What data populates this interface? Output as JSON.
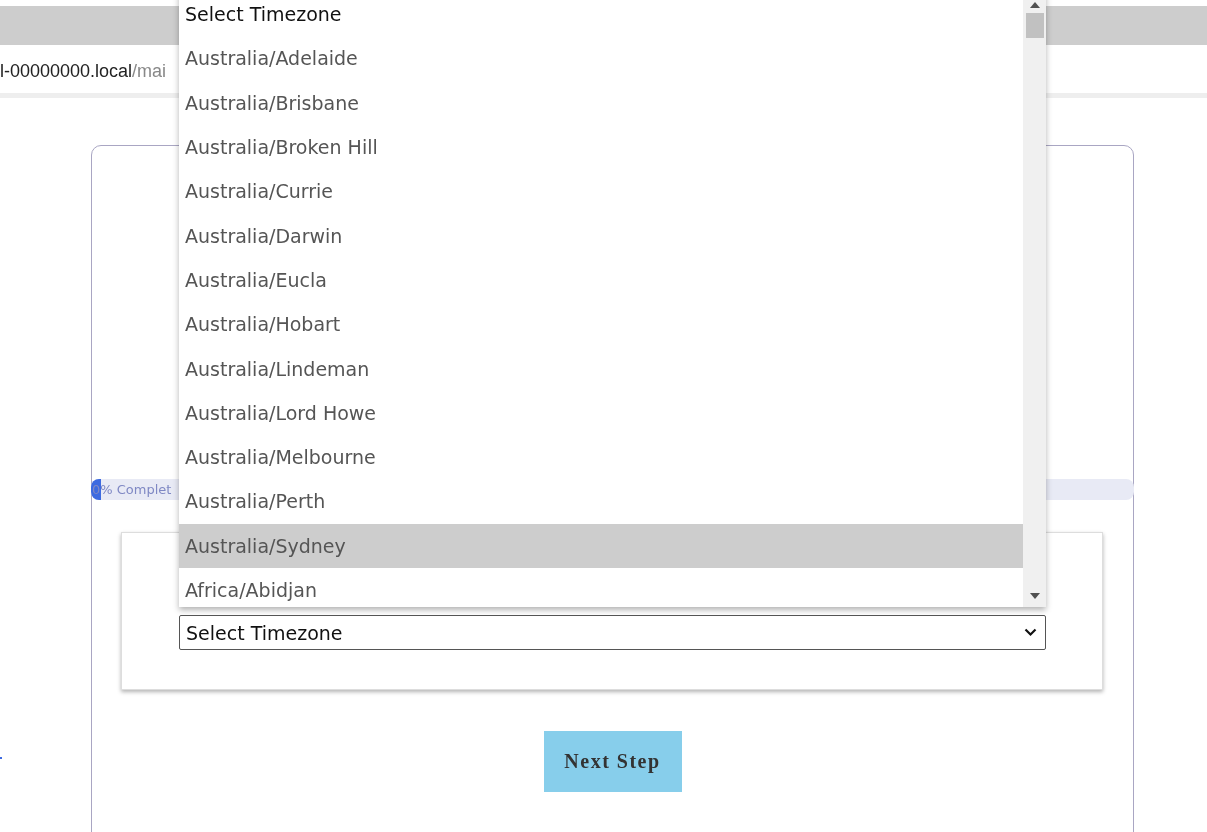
{
  "address_bar": {
    "host": "l-00000000.local",
    "path": "/mai"
  },
  "progress": {
    "label": "0% Complet",
    "level": 0.01
  },
  "timezone_select": {
    "value": "Select Timezone"
  },
  "timezone_options": [
    {
      "label": "Select Timezone",
      "kind": "prompt",
      "selected": false
    },
    {
      "label": "Australia/Adelaide",
      "kind": "zone",
      "selected": false
    },
    {
      "label": "Australia/Brisbane",
      "kind": "zone",
      "selected": false
    },
    {
      "label": "Australia/Broken Hill",
      "kind": "zone",
      "selected": false
    },
    {
      "label": "Australia/Currie",
      "kind": "zone",
      "selected": false
    },
    {
      "label": "Australia/Darwin",
      "kind": "zone",
      "selected": false
    },
    {
      "label": "Australia/Eucla",
      "kind": "zone",
      "selected": false
    },
    {
      "label": "Australia/Hobart",
      "kind": "zone",
      "selected": false
    },
    {
      "label": "Australia/Lindeman",
      "kind": "zone",
      "selected": false
    },
    {
      "label": "Australia/Lord Howe",
      "kind": "zone",
      "selected": false
    },
    {
      "label": "Australia/Melbourne",
      "kind": "zone",
      "selected": false
    },
    {
      "label": "Australia/Perth",
      "kind": "zone",
      "selected": false
    },
    {
      "label": "Australia/Sydney",
      "kind": "zone",
      "selected": true
    },
    {
      "label": "Africa/Abidjan",
      "kind": "zone",
      "selected": false
    }
  ],
  "next_button": {
    "label": "Next Step"
  }
}
